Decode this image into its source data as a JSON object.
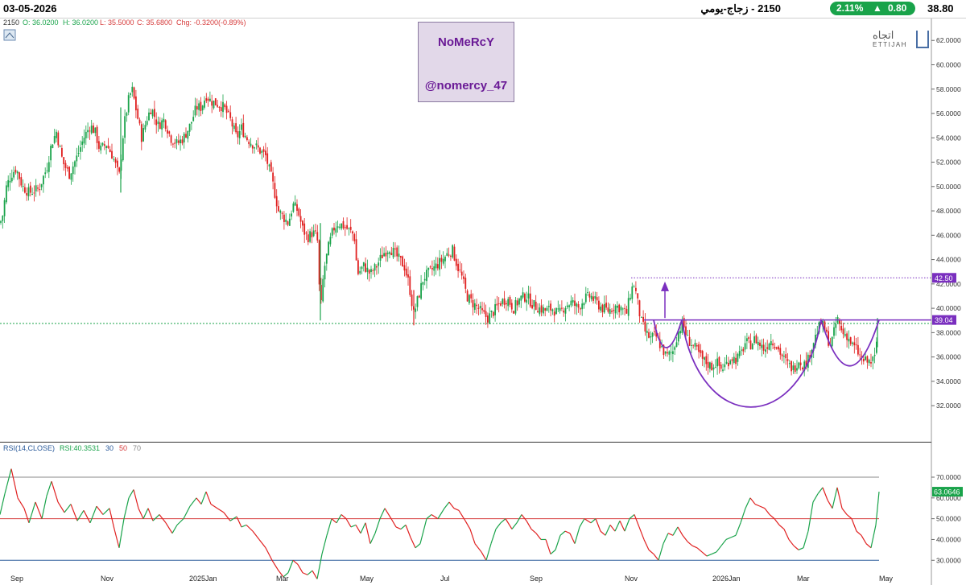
{
  "topbar": {
    "date": "03-05-2026",
    "title": "2150 - زجاج-يومي",
    "change_pct": "2.11%",
    "change_arrow": "▲",
    "change_abs": "0.80",
    "last_price": "38.80",
    "change_color": "#19a34a"
  },
  "ohlc": {
    "symbol": "2150",
    "open": "O: 36.0200",
    "high": "H: 36.0200",
    "low": "L: 35.5000",
    "close": "C: 35.6800",
    "chg": "Chg: -0.3200(-0.89%)"
  },
  "watermark": {
    "name": "NoMeRcY",
    "handle": "@nomercy_47"
  },
  "logo": {
    "arabic": "اتجاه",
    "english": "ETTIJAH",
    "icon": "ettijah-logo-icon"
  },
  "rsi_legend": {
    "label": "RSI(14,CLOSE)",
    "value": "RSI:40.3531",
    "l30": "30",
    "l50": "50",
    "l70": "70"
  },
  "chart_data": {
    "type": "candlestick",
    "date_labels": [
      "Sep",
      "Nov",
      "2025Jan",
      "Mar",
      "May",
      "Jul",
      "Sep",
      "Nov",
      "2026Jan",
      "Mar",
      "May"
    ],
    "price_axis": {
      "ticks": [
        "62.0000",
        "60.0000",
        "58.0000",
        "56.0000",
        "54.0000",
        "52.0000",
        "50.0000",
        "48.0000",
        "46.0000",
        "44.0000",
        "42.0000",
        "40.0000",
        "38.0000",
        "36.0000",
        "34.0000",
        "32.0000"
      ],
      "range": [
        29.3,
        63.8
      ]
    },
    "price_markers": [
      {
        "label": "42.50",
        "value": 42.5,
        "color": "#7a2fbf"
      },
      {
        "label": "39.04",
        "value": 39.04,
        "color": "#7a2fbf"
      }
    ],
    "support_line": {
      "value": 38.75,
      "color": "#19a34a"
    },
    "path_points": [
      [
        0,
        47.0
      ],
      [
        3,
        47.5
      ],
      [
        8,
        50.0
      ],
      [
        14,
        51.0
      ],
      [
        20,
        51.5
      ],
      [
        28,
        50.0
      ],
      [
        36,
        49.5
      ],
      [
        48,
        49.8
      ],
      [
        58,
        51.5
      ],
      [
        64,
        53.5
      ],
      [
        70,
        54.5
      ],
      [
        78,
        52.0
      ],
      [
        86,
        51.0
      ],
      [
        96,
        52.5
      ],
      [
        104,
        54.0
      ],
      [
        112,
        55.0
      ],
      [
        118,
        54.5
      ],
      [
        124,
        53.0
      ],
      [
        132,
        53.5
      ],
      [
        140,
        52.5
      ],
      [
        148,
        50.8
      ],
      [
        154,
        55.0
      ],
      [
        160,
        57.2
      ],
      [
        164,
        58.0
      ],
      [
        170,
        56.0
      ],
      [
        176,
        54.0
      ],
      [
        182,
        55.5
      ],
      [
        188,
        56.5
      ],
      [
        196,
        55.0
      ],
      [
        204,
        55.5
      ],
      [
        212,
        54.0
      ],
      [
        220,
        53.5
      ],
      [
        228,
        54.0
      ],
      [
        236,
        55.0
      ],
      [
        244,
        56.5
      ],
      [
        250,
        56.5
      ],
      [
        256,
        57.5
      ],
      [
        262,
        57.0
      ],
      [
        270,
        56.8
      ],
      [
        278,
        56.5
      ],
      [
        286,
        55.5
      ],
      [
        294,
        54.0
      ],
      [
        300,
        54.8
      ],
      [
        306,
        54.0
      ],
      [
        314,
        53.5
      ],
      [
        322,
        53.0
      ],
      [
        330,
        52.5
      ],
      [
        338,
        50.5
      ],
      [
        346,
        48.0
      ],
      [
        352,
        47.5
      ],
      [
        358,
        47.0
      ],
      [
        364,
        48.5
      ],
      [
        370,
        48.0
      ],
      [
        376,
        46.5
      ],
      [
        382,
        45.8
      ],
      [
        388,
        46.2
      ],
      [
        394,
        46.0
      ],
      [
        398,
        39.5
      ],
      [
        402,
        43.0
      ],
      [
        408,
        45.0
      ],
      [
        414,
        46.5
      ],
      [
        420,
        47.0
      ],
      [
        426,
        46.8
      ],
      [
        432,
        46.5
      ],
      [
        440,
        46.0
      ],
      [
        444,
        42.8
      ],
      [
        452,
        43.5
      ],
      [
        460,
        42.8
      ],
      [
        468,
        43.5
      ],
      [
        476,
        44.5
      ],
      [
        484,
        45.0
      ],
      [
        490,
        44.5
      ],
      [
        496,
        44.0
      ],
      [
        502,
        43.5
      ],
      [
        508,
        42.0
      ],
      [
        514,
        39.5
      ],
      [
        520,
        41.0
      ],
      [
        526,
        42.5
      ],
      [
        534,
        43.0
      ],
      [
        542,
        43.5
      ],
      [
        550,
        44.0
      ],
      [
        556,
        44.5
      ],
      [
        562,
        44.8
      ],
      [
        568,
        43.5
      ],
      [
        574,
        42.5
      ],
      [
        580,
        41.0
      ],
      [
        586,
        40.5
      ],
      [
        594,
        40.0
      ],
      [
        600,
        39.5
      ],
      [
        606,
        39.2
      ],
      [
        614,
        39.8
      ],
      [
        622,
        40.5
      ],
      [
        630,
        40.8
      ],
      [
        638,
        40.0
      ],
      [
        646,
        40.8
      ],
      [
        654,
        41.0
      ],
      [
        662,
        40.3
      ],
      [
        670,
        40.0
      ],
      [
        678,
        39.8
      ],
      [
        686,
        40.0
      ],
      [
        694,
        39.5
      ],
      [
        702,
        40.2
      ],
      [
        710,
        40.5
      ],
      [
        718,
        40.0
      ],
      [
        726,
        40.8
      ],
      [
        734,
        41.0
      ],
      [
        740,
        40.5
      ],
      [
        748,
        40.0
      ],
      [
        756,
        39.8
      ],
      [
        764,
        40.2
      ],
      [
        772,
        40.0
      ],
      [
        778,
        39.5
      ],
      [
        784,
        41.5
      ],
      [
        788,
        42.0
      ],
      [
        792,
        40.5
      ],
      [
        796,
        39.0
      ],
      [
        802,
        38.0
      ],
      [
        808,
        37.5
      ],
      [
        814,
        37.8
      ],
      [
        820,
        37.0
      ],
      [
        828,
        36.0
      ],
      [
        836,
        36.5
      ],
      [
        842,
        38.0
      ],
      [
        848,
        38.8
      ],
      [
        854,
        37.5
      ],
      [
        860,
        37.0
      ],
      [
        866,
        36.5
      ],
      [
        872,
        35.8
      ],
      [
        878,
        35.5
      ],
      [
        884,
        35.2
      ],
      [
        890,
        35.6
      ],
      [
        896,
        35.0
      ],
      [
        902,
        35.4
      ],
      [
        908,
        36.0
      ],
      [
        914,
        35.8
      ],
      [
        920,
        36.2
      ],
      [
        926,
        37.2
      ],
      [
        932,
        37.0
      ],
      [
        938,
        37.5
      ],
      [
        944,
        37.0
      ],
      [
        950,
        36.6
      ],
      [
        956,
        37.4
      ],
      [
        962,
        37.2
      ],
      [
        968,
        36.5
      ],
      [
        974,
        35.8
      ],
      [
        980,
        35.3
      ],
      [
        986,
        35.0
      ],
      [
        992,
        35.8
      ],
      [
        998,
        35.3
      ],
      [
        1004,
        35.8
      ],
      [
        1008,
        36.8
      ],
      [
        1012,
        37.5
      ],
      [
        1016,
        38.2
      ],
      [
        1020,
        38.8
      ],
      [
        1024,
        38.3
      ],
      [
        1028,
        37.5
      ],
      [
        1032,
        37.0
      ],
      [
        1036,
        38.0
      ],
      [
        1040,
        39.2
      ],
      [
        1046,
        38.0
      ],
      [
        1052,
        37.8
      ],
      [
        1058,
        37.0
      ],
      [
        1064,
        36.6
      ],
      [
        1070,
        35.8
      ],
      [
        1076,
        35.6
      ],
      [
        1082,
        35.6
      ],
      [
        1088,
        36.0
      ],
      [
        1090,
        38.8
      ]
    ],
    "annotations": {
      "resistance_label": "42.50",
      "neckline_label": "39.04",
      "pattern": "cup-and-handle"
    },
    "rsi": {
      "axis_ticks": [
        "70.0000",
        "60.0000",
        "50.0000",
        "40.0000",
        "30.0000"
      ],
      "range": [
        15,
        82
      ],
      "levels": [
        {
          "value": 70,
          "color": "#888888"
        },
        {
          "value": 50,
          "color": "#d63a3a"
        },
        {
          "value": 30,
          "color": "#2a5a9a"
        }
      ],
      "current_label": "63.0646",
      "values": [
        [
          0,
          52
        ],
        [
          6,
          62
        ],
        [
          14,
          74
        ],
        [
          22,
          60
        ],
        [
          30,
          55
        ],
        [
          36,
          48
        ],
        [
          44,
          58
        ],
        [
          52,
          50
        ],
        [
          58,
          61
        ],
        [
          64,
          68
        ],
        [
          72,
          58
        ],
        [
          80,
          53
        ],
        [
          88,
          57
        ],
        [
          96,
          49
        ],
        [
          104,
          54
        ],
        [
          112,
          48
        ],
        [
          120,
          56
        ],
        [
          128,
          52
        ],
        [
          136,
          55
        ],
        [
          142,
          45
        ],
        [
          148,
          36
        ],
        [
          154,
          50
        ],
        [
          160,
          60
        ],
        [
          166,
          64
        ],
        [
          172,
          55
        ],
        [
          178,
          50
        ],
        [
          184,
          55
        ],
        [
          190,
          49
        ],
        [
          198,
          52
        ],
        [
          206,
          48
        ],
        [
          214,
          43
        ],
        [
          220,
          47
        ],
        [
          228,
          50
        ],
        [
          236,
          56
        ],
        [
          244,
          60
        ],
        [
          250,
          57
        ],
        [
          256,
          63
        ],
        [
          262,
          57
        ],
        [
          270,
          55
        ],
        [
          278,
          53
        ],
        [
          286,
          49
        ],
        [
          294,
          51
        ],
        [
          300,
          46
        ],
        [
          306,
          47
        ],
        [
          314,
          44
        ],
        [
          322,
          40
        ],
        [
          330,
          36
        ],
        [
          338,
          30
        ],
        [
          346,
          25
        ],
        [
          352,
          22
        ],
        [
          358,
          24
        ],
        [
          364,
          30
        ],
        [
          370,
          28
        ],
        [
          376,
          24
        ],
        [
          382,
          23
        ],
        [
          388,
          25
        ],
        [
          394,
          21
        ],
        [
          400,
          33
        ],
        [
          406,
          42
        ],
        [
          412,
          50
        ],
        [
          418,
          48
        ],
        [
          424,
          52
        ],
        [
          430,
          50
        ],
        [
          436,
          46
        ],
        [
          442,
          47
        ],
        [
          448,
          43
        ],
        [
          454,
          48
        ],
        [
          460,
          38
        ],
        [
          466,
          43
        ],
        [
          472,
          50
        ],
        [
          478,
          55
        ],
        [
          486,
          50
        ],
        [
          492,
          46
        ],
        [
          498,
          45
        ],
        [
          504,
          47
        ],
        [
          510,
          41
        ],
        [
          516,
          36
        ],
        [
          522,
          38
        ],
        [
          530,
          50
        ],
        [
          536,
          52
        ],
        [
          544,
          50
        ],
        [
          552,
          55
        ],
        [
          558,
          58
        ],
        [
          564,
          55
        ],
        [
          570,
          54
        ],
        [
          578,
          49
        ],
        [
          584,
          45
        ],
        [
          590,
          38
        ],
        [
          598,
          34
        ],
        [
          604,
          30
        ],
        [
          610,
          38
        ],
        [
          616,
          45
        ],
        [
          622,
          48
        ],
        [
          628,
          50
        ],
        [
          636,
          45
        ],
        [
          642,
          48
        ],
        [
          648,
          52
        ],
        [
          654,
          49
        ],
        [
          660,
          45
        ],
        [
          666,
          43
        ],
        [
          672,
          40
        ],
        [
          678,
          40
        ],
        [
          684,
          33
        ],
        [
          690,
          35
        ],
        [
          696,
          42
        ],
        [
          702,
          44
        ],
        [
          708,
          43
        ],
        [
          714,
          38
        ],
        [
          720,
          46
        ],
        [
          726,
          50
        ],
        [
          734,
          48
        ],
        [
          740,
          50
        ],
        [
          746,
          44
        ],
        [
          752,
          42
        ],
        [
          758,
          47
        ],
        [
          764,
          44
        ],
        [
          770,
          49
        ],
        [
          776,
          44
        ],
        [
          782,
          50
        ],
        [
          788,
          52
        ],
        [
          794,
          46
        ],
        [
          800,
          40
        ],
        [
          806,
          35
        ],
        [
          812,
          33
        ],
        [
          818,
          30
        ],
        [
          824,
          38
        ],
        [
          830,
          43
        ],
        [
          836,
          42
        ],
        [
          842,
          46
        ],
        [
          848,
          42
        ],
        [
          854,
          39
        ],
        [
          860,
          37
        ],
        [
          866,
          36
        ],
        [
          872,
          34
        ],
        [
          878,
          32
        ],
        [
          884,
          33
        ],
        [
          890,
          34
        ],
        [
          896,
          37
        ],
        [
          902,
          40
        ],
        [
          908,
          41
        ],
        [
          914,
          42
        ],
        [
          920,
          48
        ],
        [
          926,
          55
        ],
        [
          932,
          60
        ],
        [
          938,
          57
        ],
        [
          944,
          56
        ],
        [
          950,
          55
        ],
        [
          956,
          52
        ],
        [
          962,
          50
        ],
        [
          968,
          47
        ],
        [
          974,
          45
        ],
        [
          980,
          40
        ],
        [
          986,
          37
        ],
        [
          992,
          35
        ],
        [
          998,
          36
        ],
        [
          1004,
          44
        ],
        [
          1010,
          58
        ],
        [
          1016,
          62
        ],
        [
          1022,
          65
        ],
        [
          1028,
          59
        ],
        [
          1034,
          55
        ],
        [
          1040,
          65
        ],
        [
          1046,
          55
        ],
        [
          1052,
          52
        ],
        [
          1058,
          50
        ],
        [
          1064,
          44
        ],
        [
          1070,
          42
        ],
        [
          1076,
          38
        ],
        [
          1082,
          36
        ],
        [
          1088,
          47
        ],
        [
          1092,
          63
        ]
      ]
    }
  }
}
